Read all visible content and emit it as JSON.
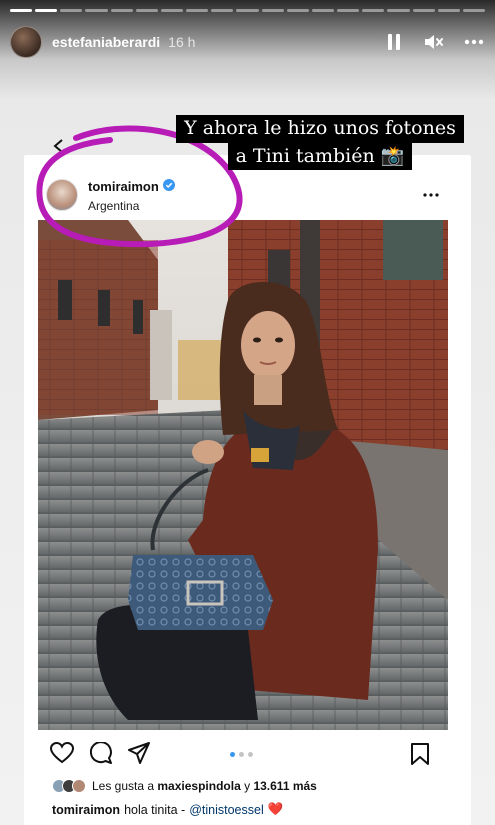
{
  "story": {
    "username": "estefaniaberardi",
    "time": "16 h",
    "progress_segments": [
      1,
      1,
      0,
      0,
      0,
      0,
      0,
      0,
      0,
      0,
      0,
      0,
      0,
      0,
      0,
      0,
      0,
      0,
      0
    ],
    "caption_lines": [
      "Y ahora le hizo unos fotones",
      "a Tini también 📸"
    ]
  },
  "post": {
    "username": "tomiraimon",
    "location": "Argentina",
    "verified": true,
    "carousel_pages": 3,
    "carousel_active": 0,
    "likes_prefix": "Les gusta a",
    "likes_user": "maxiespindola",
    "likes_joiner": "y",
    "likes_count": "13.611 más",
    "comment_user": "tomiraimon",
    "comment_text": "hola tinita -",
    "comment_mention": "@tinistoessel",
    "comment_emoji": "❤️"
  },
  "colors": {
    "highlight": "#b71cb7",
    "verified": "#3897f0",
    "carousel_active": "#3897f0"
  },
  "icons": [
    "pause-icon",
    "mute-icon",
    "more-icon",
    "back-arrow-icon",
    "verified-icon",
    "heart-icon",
    "comment-icon",
    "share-icon",
    "bookmark-icon"
  ]
}
